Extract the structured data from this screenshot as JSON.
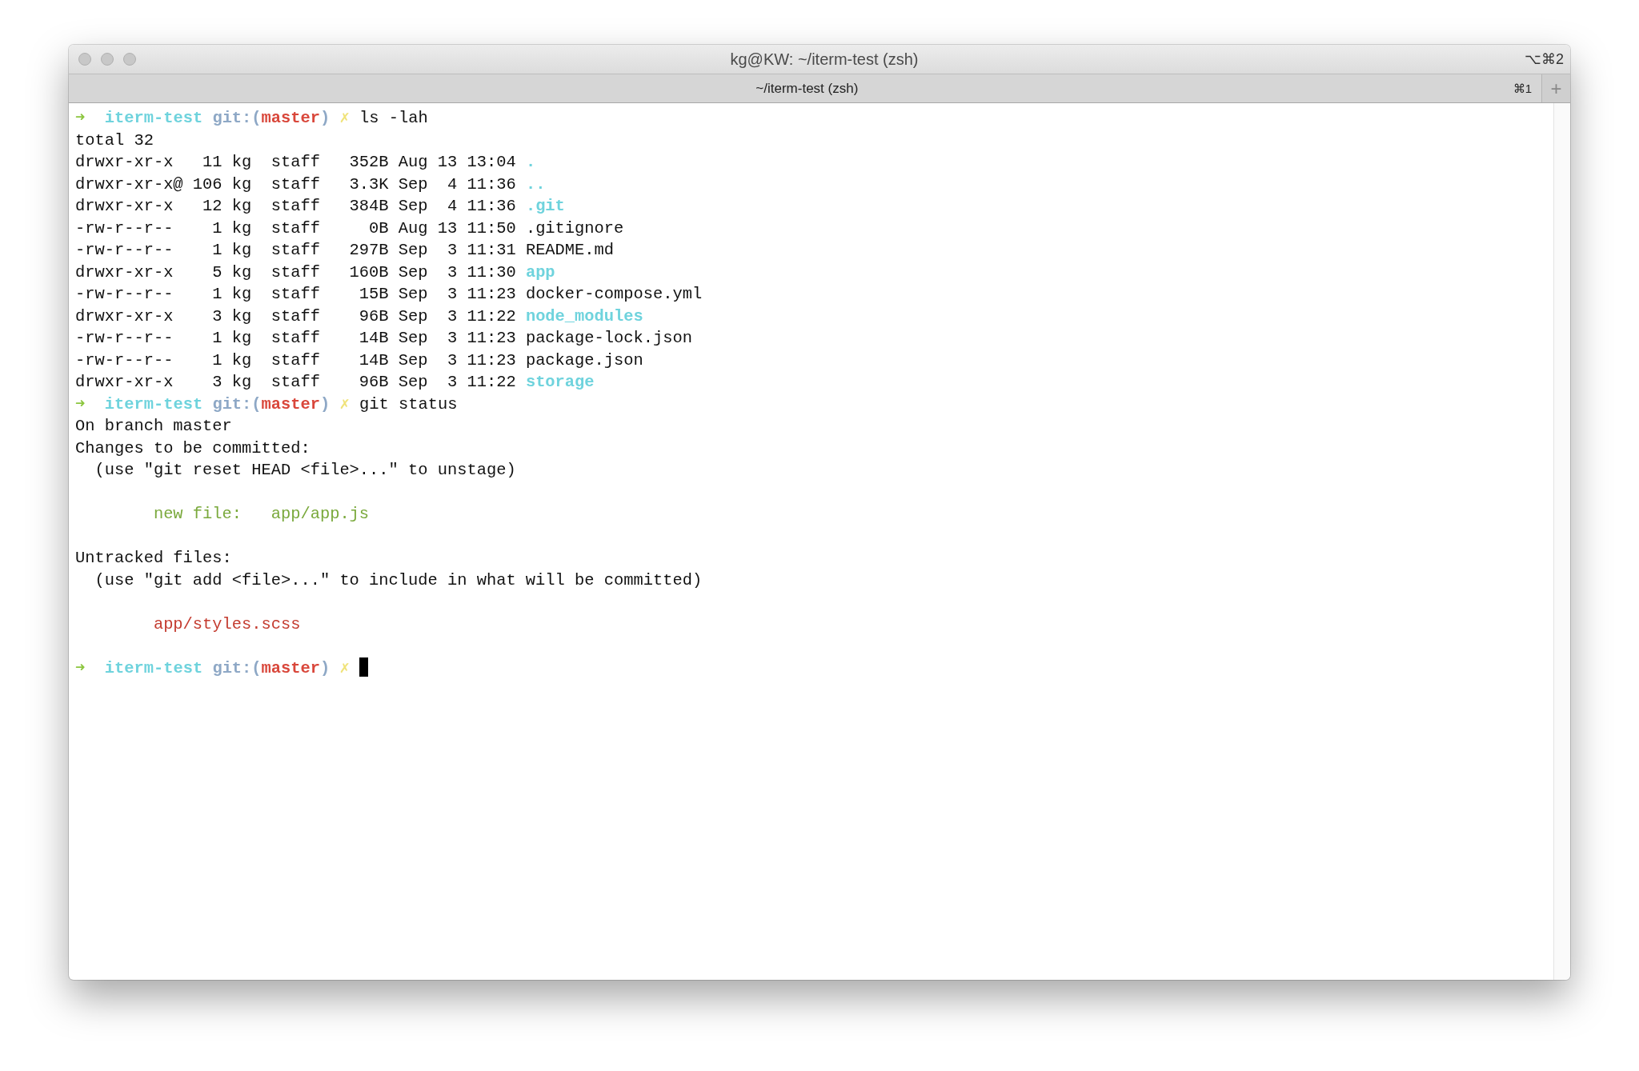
{
  "window": {
    "title": "kg@KW: ~/iterm-test (zsh)",
    "shortcut": "⌥⌘2"
  },
  "tabs": [
    {
      "label": "~/iterm-test (zsh)",
      "shortcut": "⌘1",
      "selected": true
    }
  ],
  "new_tab_button": "+",
  "terminal": {
    "lines": [
      {
        "kind": "text",
        "segments": [
          {
            "kind": "arrow",
            "text": "➜"
          },
          {
            "kind": "directory",
            "text": "iterm-test"
          },
          {
            "kind": "git",
            "text": "git:("
          },
          {
            "kind": "branch",
            "text": "master"
          },
          {
            "kind": "git",
            "text": ")"
          },
          {
            "kind": "dirty",
            "text": "✗"
          },
          {
            "kind": "plain",
            "text": "ls -lah"
          }
        ]
      },
      {
        "kind": "text",
        "segments": [
          {
            "kind": "plain",
            "text": "total 32"
          }
        ]
      },
      {
        "kind": "text",
        "segments": [
          {
            "kind": "plain",
            "text": "drwxr-xr-x   11 kg  staff   352B Aug 13 13:04"
          },
          {
            "kind": "folder",
            "text": "."
          }
        ]
      },
      {
        "kind": "text",
        "segments": [
          {
            "kind": "plain",
            "text": "drwxr-xr-x@ 106 kg  staff   3.3K Sep  4 11:36"
          },
          {
            "kind": "folder",
            "text": ".."
          }
        ]
      },
      {
        "kind": "text",
        "segments": [
          {
            "kind": "plain",
            "text": "drwxr-xr-x   12 kg  staff   384B Sep  4 11:36"
          },
          {
            "kind": "folder",
            "text": ".git"
          }
        ]
      },
      {
        "kind": "text",
        "segments": [
          {
            "kind": "plain",
            "text": "-rw-r--r--    1 kg  staff     0B Aug 13 11:50"
          },
          {
            "kind": "file",
            "text": ".gitignore"
          }
        ]
      },
      {
        "kind": "text",
        "segments": [
          {
            "kind": "plain",
            "text": "-rw-r--r--    1 kg  staff   297B Sep  3 11:31"
          },
          {
            "kind": "file",
            "text": "README.md"
          }
        ]
      },
      {
        "kind": "text",
        "segments": [
          {
            "kind": "plain",
            "text": "drwxr-xr-x    5 kg  staff   160B Sep  3 11:30"
          },
          {
            "kind": "folder",
            "text": "app"
          }
        ]
      },
      {
        "kind": "text",
        "segments": [
          {
            "kind": "plain",
            "text": "-rw-r--r--    1 kg  staff    15B Sep  3 11:23"
          },
          {
            "kind": "file",
            "text": "docker-compose.yml"
          }
        ]
      },
      {
        "kind": "text",
        "segments": [
          {
            "kind": "plain",
            "text": "drwxr-xr-x    3 kg  staff    96B Sep  3 11:22"
          },
          {
            "kind": "folder",
            "text": "node_modules"
          }
        ]
      },
      {
        "kind": "text",
        "segments": [
          {
            "kind": "plain",
            "text": "-rw-r--r--    1 kg  staff    14B Sep  3 11:23"
          },
          {
            "kind": "file",
            "text": "package-lock.json"
          }
        ]
      },
      {
        "kind": "text",
        "segments": [
          {
            "kind": "plain",
            "text": "-rw-r--r--    1 kg  staff    14B Sep  3 11:23"
          },
          {
            "kind": "file",
            "text": "package.json"
          }
        ]
      },
      {
        "kind": "text",
        "segments": [
          {
            "kind": "plain",
            "text": "drwxr-xr-x    3 kg  staff    96B Sep  3 11:22"
          },
          {
            "kind": "folder",
            "text": "storage"
          }
        ]
      },
      {
        "kind": "text",
        "segments": [
          {
            "kind": "arrow",
            "text": "➜"
          },
          {
            "kind": "directory",
            "text": "iterm-test"
          },
          {
            "kind": "git",
            "text": "git:("
          },
          {
            "kind": "branch",
            "text": "master"
          },
          {
            "kind": "git",
            "text": ")"
          },
          {
            "kind": "dirty",
            "text": "✗"
          },
          {
            "kind": "plain",
            "text": "git status"
          }
        ]
      },
      {
        "kind": "text",
        "segments": [
          {
            "kind": "plain",
            "text": "On branch master"
          }
        ]
      },
      {
        "kind": "text",
        "segments": [
          {
            "kind": "plain",
            "text": "Changes to be committed:"
          }
        ]
      },
      {
        "kind": "text",
        "segments": [
          {
            "kind": "plain",
            "text": "  (use \"git reset HEAD <file>...\" to unstage)"
          }
        ]
      },
      {
        "kind": "blank"
      },
      {
        "kind": "text",
        "segments": [
          {
            "kind": "staged",
            "text": "        new file:   app/app.js"
          }
        ]
      },
      {
        "kind": "blank"
      },
      {
        "kind": "text",
        "segments": [
          {
            "kind": "plain",
            "text": "Untracked files:"
          }
        ]
      },
      {
        "kind": "text",
        "segments": [
          {
            "kind": "plain",
            "text": "  (use \"git add <file>...\" to include in what will be committed)"
          }
        ]
      },
      {
        "kind": "blank"
      },
      {
        "kind": "text",
        "segments": [
          {
            "kind": "untracked",
            "text": "        app/styles.scss"
          }
        ]
      },
      {
        "kind": "blank"
      },
      {
        "kind": "text",
        "cursor": true,
        "segments": [
          {
            "kind": "arrow",
            "text": "➜"
          },
          {
            "kind": "directory",
            "text": "iterm-test"
          },
          {
            "kind": "git",
            "text": "git:("
          },
          {
            "kind": "branch",
            "text": "master"
          },
          {
            "kind": "git",
            "text": ")"
          },
          {
            "kind": "dirty",
            "text": "✗"
          }
        ]
      }
    ]
  }
}
